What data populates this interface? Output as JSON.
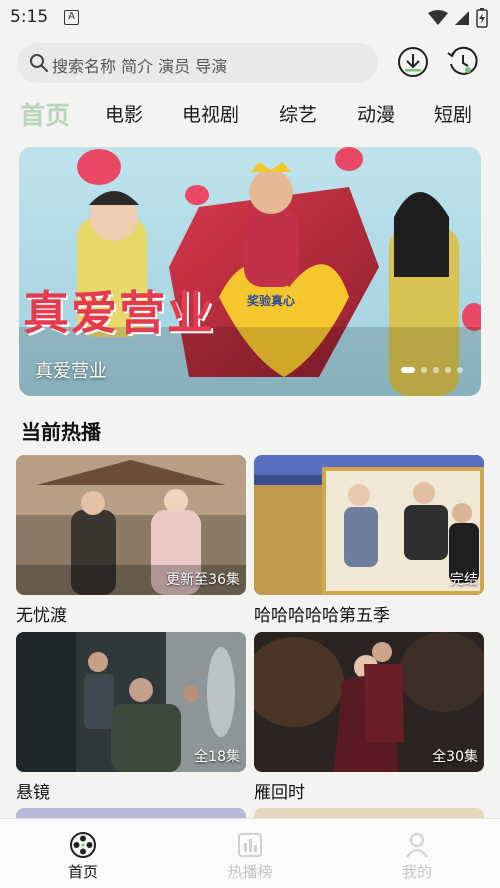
{
  "status": {
    "time": "5:15",
    "notif_letter": "A"
  },
  "search": {
    "placeholder": "搜索名称 简介 演员 导演"
  },
  "tabs": [
    {
      "label": "首页",
      "active": true
    },
    {
      "label": "电影"
    },
    {
      "label": "电视剧"
    },
    {
      "label": "综艺"
    },
    {
      "label": "动漫"
    },
    {
      "label": "短剧"
    }
  ],
  "banner": {
    "caption": "真爱营业",
    "title_art": "真爱营业",
    "heart_text": "奖验真心",
    "slide_count": 5,
    "active_slide": 1
  },
  "section": {
    "title": "当前热播"
  },
  "cards": [
    {
      "title": "无忧渡",
      "badge": "更新至36集"
    },
    {
      "title": "哈哈哈哈哈第五季",
      "badge": "完结"
    },
    {
      "title": "悬镜",
      "badge": "全18集"
    },
    {
      "title": "雁回时",
      "badge": "全30集"
    }
  ],
  "nav": [
    {
      "label": "首页",
      "icon": "film-reel-icon",
      "active": true
    },
    {
      "label": "热播榜",
      "icon": "chart-icon",
      "active": false
    },
    {
      "label": "我的",
      "icon": "profile-icon",
      "active": false
    }
  ],
  "colors": {
    "accent": "#b9d4b8",
    "tab_text": "#1a1a1a",
    "inactive_nav": "#c4c4c4"
  }
}
